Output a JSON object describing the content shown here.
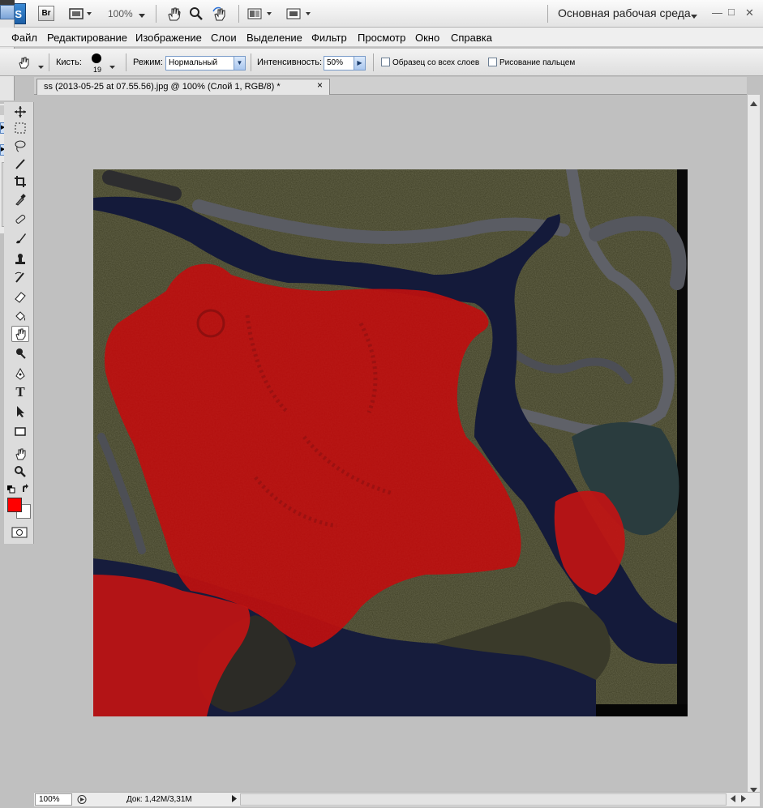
{
  "appbar": {
    "logo_text": "PS",
    "bridge_text": "Br",
    "zoom": "100%",
    "workspace": "Основная рабочая среда"
  },
  "menu": [
    "Файл",
    "Редактирование",
    "Изображение",
    "Слои",
    "Выделение",
    "Фильтр",
    "Просмотр",
    "Окно",
    "Справка"
  ],
  "options": {
    "brush_label": "Кисть:",
    "brush_size": "19",
    "mode_label": "Режим:",
    "mode_value": "Нормальный",
    "intensity_label": "Интенсивность:",
    "intensity_value": "50%",
    "sample_all_layers": "Образец со всех слоев",
    "finger_painting": "Рисование пальцем"
  },
  "document": {
    "tab_title": "ss (2013-05-25 at 07.55.56).jpg @ 100% (Слой 1, RGB/8) *",
    "close": "×"
  },
  "status": {
    "zoom": "100%",
    "doc": "Док: 1,42M/3,31M"
  },
  "colors": {
    "foreground": "#ff0000",
    "background": "#ffffff"
  }
}
